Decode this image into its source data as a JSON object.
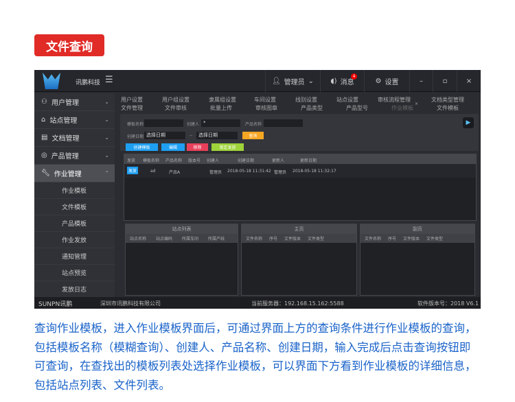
{
  "title": "文件查询",
  "app": {
    "brand": "讯鹏科技",
    "user": "管理员",
    "messages": "消息",
    "msg_badge": "4",
    "settings": "设置",
    "minimize": "–",
    "restore": "▫",
    "close": "×"
  },
  "sidebar": {
    "items": [
      {
        "label": "用户管理"
      },
      {
        "label": "站点管理"
      },
      {
        "label": "文档管理"
      },
      {
        "label": "产品管理"
      },
      {
        "label": "作业管理"
      }
    ],
    "sub": [
      "作业模板",
      "文件模板",
      "产品模板",
      "作业发放",
      "通知管理",
      "站点预览",
      "发放日志"
    ]
  },
  "tabs": {
    "row1": [
      "用户设置",
      "用户组设置",
      "隶属组设置",
      "车间设置",
      "线别设置",
      "站点设置",
      "审核流程管理",
      "文档类型管理"
    ],
    "row2": [
      "文件管理",
      "文件审核",
      "批量上传",
      "审核图章",
      "产品类型",
      "产品型号",
      "作业模板",
      "文件模板"
    ]
  },
  "query": {
    "template_name": "模板名称",
    "creator": "创建人",
    "creator_value": "*",
    "product_name": "产品名称",
    "created_date": "创建日期",
    "date_placeholder": "选择日期",
    "date_sep": "--",
    "search": "查询",
    "create": "创建模板",
    "edit": "编辑",
    "delete": "移除",
    "lock": "锁定发放"
  },
  "grid": {
    "headers": [
      "发放",
      "模板名称",
      "产品名称",
      "版本号",
      "创建人",
      "创建日期",
      "更新人",
      "更新日期"
    ],
    "rows": [
      {
        "action": "发放",
        "name": "ad",
        "product": "产品A",
        "version": "",
        "creator": "管理员",
        "created": "2018-05-18 11:31:42",
        "updater": "管理员",
        "updated": "2018-05-18 11:32:17"
      }
    ]
  },
  "panels": [
    {
      "title": "站点列表",
      "cols": [
        "站点名称",
        "站点编码",
        "所属车间",
        "所属产线"
      ]
    },
    {
      "title": "主页",
      "cols": [
        "文件名称",
        "序号",
        "文件版本",
        "文件类型"
      ]
    },
    {
      "title": "副页",
      "cols": [
        "文件名称",
        "序号",
        "文件版本",
        "文件类型"
      ]
    }
  ],
  "status": {
    "logo": "SUNPN讯鹏",
    "company": "深圳市讯鹏科技有限公司",
    "server": "当前服务器：192.168.15.162:5588",
    "version": "软件版本号：2018 V6.1"
  },
  "description": "查询作业模板，进入作业模板界面后，可通过界面上方的查询条件进行作业模板的查询，包括模板名称（模糊查询）、创建人、产品名称、创建日期，输入完成后点击查询按钮即可查询，在查找出的模板列表处选择作业模板，可以界面下方看到作业模板的详细信息，包括站点列表、文件列表。",
  "colors": {
    "accent_red": "#e02b27",
    "text_blue": "#1a63c9",
    "btn_blue": "#1e9ff2",
    "btn_orange": "#f5a623",
    "btn_green": "#9ed33a"
  }
}
